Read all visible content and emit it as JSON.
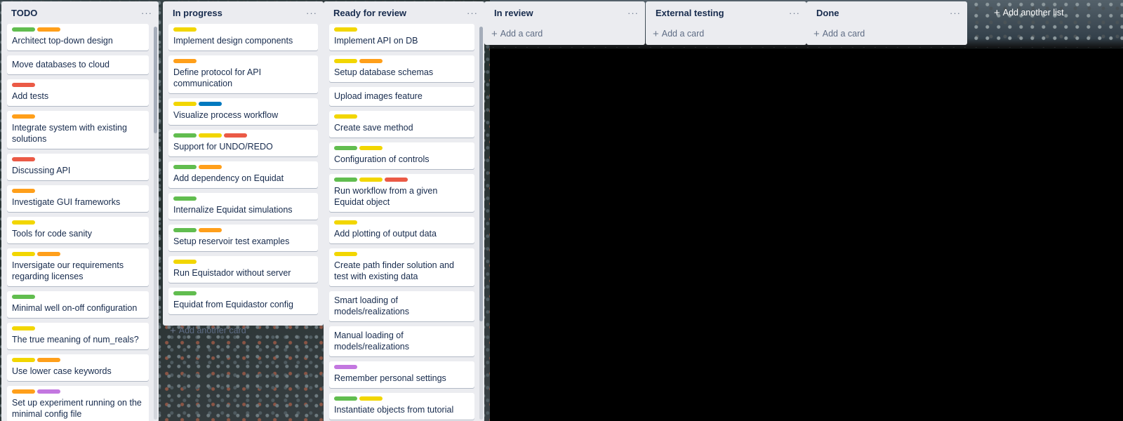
{
  "colors": {
    "green": "#61bd4f",
    "orange": "#ff9f1a",
    "red": "#eb5a46",
    "yellow": "#f2d600",
    "blue": "#0079bf",
    "purple": "#c377e0"
  },
  "icons": {
    "list_menu": "horizontal-ellipsis-icon",
    "add": "plus-icon"
  },
  "add_list_label": "Add another list",
  "lists": [
    {
      "title": "TODO",
      "cards": [
        {
          "labels": [
            "green",
            "orange"
          ],
          "title": "Architect top-down design"
        },
        {
          "labels": [],
          "title": "Move databases to cloud"
        },
        {
          "labels": [
            "red"
          ],
          "title": "Add tests"
        },
        {
          "labels": [
            "orange"
          ],
          "title": "Integrate system with existing solutions"
        },
        {
          "labels": [
            "red"
          ],
          "title": "Discussing API"
        },
        {
          "labels": [
            "orange"
          ],
          "title": "Investigate GUI frameworks"
        },
        {
          "labels": [
            "yellow"
          ],
          "title": "Tools for code sanity"
        },
        {
          "labels": [
            "yellow",
            "orange"
          ],
          "title": "Inversigate our requirements regarding licenses"
        },
        {
          "labels": [
            "green"
          ],
          "title": "Minimal well on-off configuration"
        },
        {
          "labels": [
            "yellow"
          ],
          "title": "The true meaning of num_reals?"
        },
        {
          "labels": [
            "yellow",
            "orange"
          ],
          "title": "Use lower case keywords"
        },
        {
          "labels": [
            "orange",
            "purple"
          ],
          "title": "Set up experiment running on the minimal config file"
        }
      ],
      "add_card": ""
    },
    {
      "title": "In progress",
      "cards": [
        {
          "labels": [
            "yellow"
          ],
          "title": "Implement design components"
        },
        {
          "labels": [
            "orange"
          ],
          "title": "Define protocol for API communication"
        },
        {
          "labels": [
            "yellow",
            "blue"
          ],
          "title": "Visualize process workflow"
        },
        {
          "labels": [
            "green",
            "yellow",
            "red"
          ],
          "title": "Support for UNDO/REDO"
        },
        {
          "labels": [
            "green",
            "orange"
          ],
          "title": "Add dependency on Equidat"
        },
        {
          "labels": [
            "green"
          ],
          "title": "Internalize Equidat simulations"
        },
        {
          "labels": [
            "green",
            "orange"
          ],
          "title": "Setup reservoir test examples"
        },
        {
          "labels": [
            "yellow"
          ],
          "title": "Run Equistador without server"
        },
        {
          "labels": [
            "green"
          ],
          "title": "Equidat from Equidastor config"
        }
      ],
      "add_card": "Add another card"
    },
    {
      "title": "Ready for review",
      "cards": [
        {
          "labels": [
            "yellow"
          ],
          "title": "Implement API on DB"
        },
        {
          "labels": [
            "yellow",
            "orange"
          ],
          "title": "Setup database schemas"
        },
        {
          "labels": [],
          "title": "Upload images feature"
        },
        {
          "labels": [
            "yellow"
          ],
          "title": "Create save method"
        },
        {
          "labels": [
            "green",
            "yellow"
          ],
          "title": "Configuration of controls"
        },
        {
          "labels": [
            "green",
            "yellow",
            "red"
          ],
          "title": "Run workflow from a given Equidat object"
        },
        {
          "labels": [
            "yellow"
          ],
          "title": "Add plotting of output data"
        },
        {
          "labels": [
            "yellow"
          ],
          "title": "Create path finder solution and test with existing data"
        },
        {
          "labels": [],
          "title": "Smart loading of models/realizations"
        },
        {
          "labels": [],
          "title": "Manual loading of models/realizations"
        },
        {
          "labels": [
            "purple"
          ],
          "title": "Remember personal settings"
        },
        {
          "labels": [
            "green",
            "yellow"
          ],
          "title": "Instantiate objects from tutorial"
        },
        {
          "labels": [
            "green"
          ],
          "title": ""
        }
      ],
      "add_card": ""
    },
    {
      "title": "In review",
      "cards": [],
      "add_card": "Add a card"
    },
    {
      "title": "External testing",
      "cards": [],
      "add_card": "Add a card"
    },
    {
      "title": "Done",
      "cards": [],
      "add_card": "Add a card"
    }
  ]
}
